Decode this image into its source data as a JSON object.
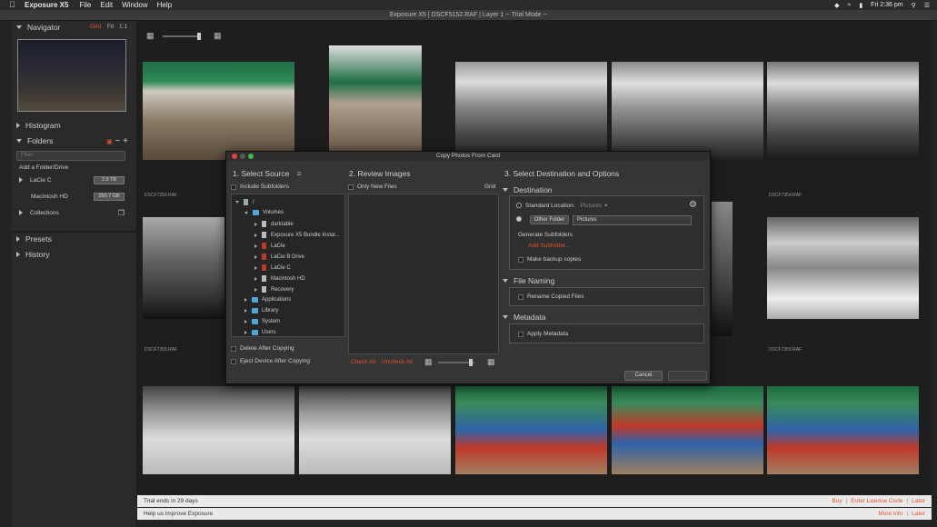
{
  "menubar": {
    "app": "Exposure X5",
    "items": [
      "File",
      "Edit",
      "Window",
      "Help"
    ],
    "clock": "Fri 2:36 pm"
  },
  "window_title": "Exposure X5 | DSCF5152.RAF | Layer 1 -- Trial Mode --",
  "sidebar": {
    "navigator": {
      "label": "Navigator",
      "opts": [
        "Grid",
        "Fit",
        "1:1"
      ]
    },
    "histogram": "Histogram",
    "folders": {
      "label": "Folders",
      "filter_placeholder": "Filter",
      "add": "Add a Folder/Drive",
      "drives": [
        {
          "name": "LaCie C",
          "size": "2.0 TB"
        },
        {
          "name": "Macintosh HD",
          "size": "250.7 GB"
        }
      ],
      "collections": "Collections"
    },
    "presets": "Presets",
    "history": "History"
  },
  "grid": {
    "captions": [
      "DSCF7350.RAF",
      "DSCF7354.RAF",
      "DSCF7355.RAF",
      "DSCF7359.RAF"
    ]
  },
  "dialog": {
    "title": "Copy Photos From Card",
    "source": {
      "header": "1. Select Source",
      "include_sub": "Include Subfolders",
      "delete_after": "Delete After Copying",
      "eject_after": "Eject Device After Copying"
    },
    "tree": {
      "root": "/",
      "volumes": "Volumes",
      "vol_items": [
        "darktable",
        "Exposure X5 Bundle Instal...",
        "LaCie",
        "LaCie B Drive",
        "LaCie C",
        "Macintosh HD",
        "Recovery"
      ],
      "folders": [
        "Applications",
        "Library",
        "System",
        "Users"
      ]
    },
    "review": {
      "header": "2. Review Images",
      "only_new": "Only New Files",
      "grid": "Grid",
      "check_all": "Check All",
      "uncheck_all": "Uncheck All"
    },
    "dest": {
      "header": "3. Select Destination and Options",
      "destination": "Destination",
      "standard": "Standard Location:",
      "pictures_dd": "Pictures",
      "other_folder": "Other Folder",
      "other_value": "Pictures",
      "gen_sub": "Generate Subfolders",
      "add_sub": "Add Subfolder...",
      "backup": "Make backup copies",
      "file_naming": "File Naming",
      "rename": "Rename Copied Files",
      "metadata": "Metadata",
      "apply_meta": "Apply Metadata"
    },
    "cancel": "Cancel"
  },
  "bottom": {
    "trial": "Trial ends in 29 days",
    "buy": "Buy",
    "license": "Enter License Code",
    "later": "Later",
    "improve": "Help us improve Exposure",
    "more": "More info",
    "later2": "Later"
  }
}
